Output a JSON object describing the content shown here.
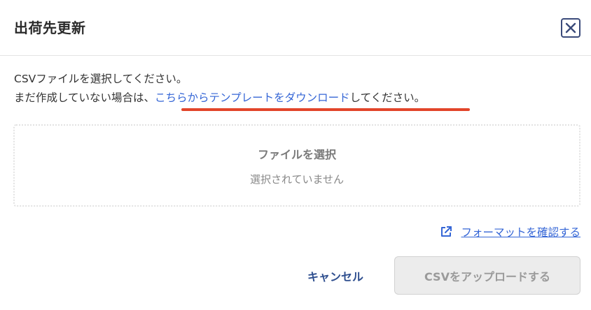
{
  "dialog": {
    "title": "出荷先更新",
    "close_icon": "close-icon"
  },
  "description": {
    "line1": "CSVファイルを選択してください。",
    "line2_prefix": "まだ作成していない場合は、",
    "template_link": "こちらからテンプレートをダウンロード",
    "line2_suffix": "してください。",
    "highlight_color": "#e2452a"
  },
  "dropzone": {
    "title": "ファイルを選択",
    "status": "選択されていません"
  },
  "format_link": {
    "icon": "external-link-icon",
    "label": "フォーマットを確認する"
  },
  "actions": {
    "cancel_label": "キャンセル",
    "upload_label": "CSVをアップロードする"
  },
  "colors": {
    "link": "#3566d6",
    "cancel": "#2f4f8f",
    "disabled_bg": "#ececec"
  }
}
